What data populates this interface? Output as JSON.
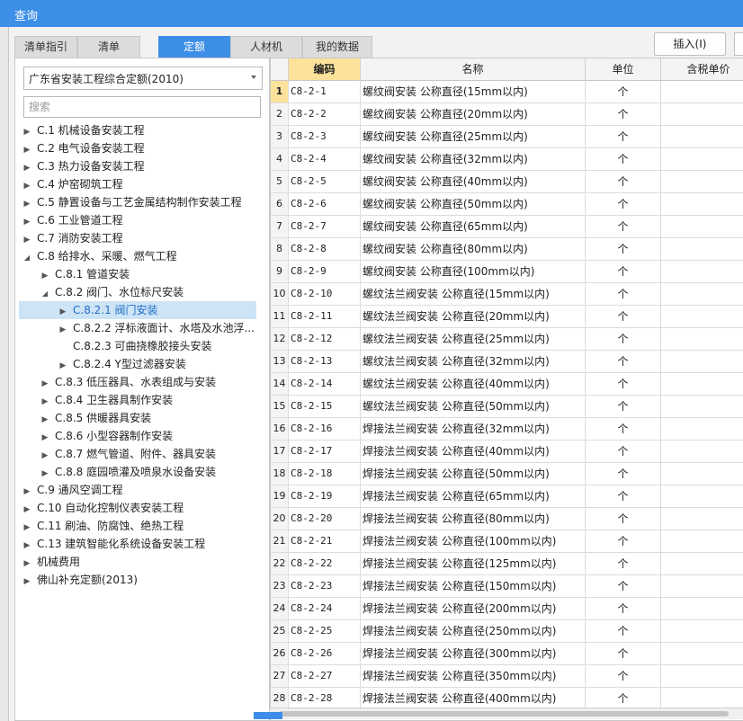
{
  "window": {
    "title": "查询"
  },
  "tabs": [
    {
      "label": "清单指引",
      "active": false
    },
    {
      "label": "清单",
      "active": false
    },
    {
      "label": "定额",
      "active": true
    },
    {
      "label": "人材机",
      "active": false
    },
    {
      "label": "我的数据",
      "active": false
    }
  ],
  "toolbar": {
    "insert_label": "插入(I)"
  },
  "left": {
    "library_select": "广东省安装工程综合定额(2010)",
    "search_placeholder": "搜索",
    "tree": [
      {
        "label": "C.1 机械设备安装工程",
        "level": 0,
        "caret": "right"
      },
      {
        "label": "C.2 电气设备安装工程",
        "level": 0,
        "caret": "right"
      },
      {
        "label": "C.3 热力设备安装工程",
        "level": 0,
        "caret": "right"
      },
      {
        "label": "C.4 炉窑砌筑工程",
        "level": 0,
        "caret": "right"
      },
      {
        "label": "C.5 静置设备与工艺金属结构制作安装工程",
        "level": 0,
        "caret": "right"
      },
      {
        "label": "C.6 工业管道工程",
        "level": 0,
        "caret": "right"
      },
      {
        "label": "C.7 消防安装工程",
        "level": 0,
        "caret": "right"
      },
      {
        "label": "C.8 给排水、采暖、燃气工程",
        "level": 0,
        "caret": "down"
      },
      {
        "label": "C.8.1 管道安装",
        "level": 1,
        "caret": "right"
      },
      {
        "label": "C.8.2 阀门、水位标尺安装",
        "level": 1,
        "caret": "down"
      },
      {
        "label": "C.8.2.1 阀门安装",
        "level": 2,
        "caret": "right",
        "selected": true
      },
      {
        "label": "C.8.2.2 浮标液面计、水塔及水池浮...",
        "level": 2,
        "caret": "right"
      },
      {
        "label": "C.8.2.3 可曲挠橡胶接头安装",
        "level": 2,
        "caret": "none"
      },
      {
        "label": "C.8.2.4 Y型过滤器安装",
        "level": 2,
        "caret": "right"
      },
      {
        "label": "C.8.3 低压器具、水表组成与安装",
        "level": 1,
        "caret": "right"
      },
      {
        "label": "C.8.4 卫生器具制作安装",
        "level": 1,
        "caret": "right"
      },
      {
        "label": "C.8.5 供暖器具安装",
        "level": 1,
        "caret": "right"
      },
      {
        "label": "C.8.6 小型容器制作安装",
        "level": 1,
        "caret": "right"
      },
      {
        "label": "C.8.7 燃气管道、附件、器具安装",
        "level": 1,
        "caret": "right"
      },
      {
        "label": "C.8.8 庭园喷灌及喷泉水设备安装",
        "level": 1,
        "caret": "right"
      },
      {
        "label": "C.9 通风空调工程",
        "level": 0,
        "caret": "right"
      },
      {
        "label": "C.10 自动化控制仪表安装工程",
        "level": 0,
        "caret": "right"
      },
      {
        "label": "C.11 刷油、防腐蚀、绝热工程",
        "level": 0,
        "caret": "right"
      },
      {
        "label": "C.13 建筑智能化系统设备安装工程",
        "level": 0,
        "caret": "right"
      },
      {
        "label": "机械费用",
        "level": 0,
        "caret": "right"
      },
      {
        "label": "佛山补充定额(2013)",
        "level": 0,
        "caret": "right"
      }
    ]
  },
  "grid": {
    "columns": [
      "编码",
      "名称",
      "单位",
      "含税单价"
    ],
    "rows": [
      {
        "no": "1",
        "code": "C8-2-1",
        "name": "螺纹阀安装 公称直径(15mm以内)",
        "unit": "个"
      },
      {
        "no": "2",
        "code": "C8-2-2",
        "name": "螺纹阀安装 公称直径(20mm以内)",
        "unit": "个"
      },
      {
        "no": "3",
        "code": "C8-2-3",
        "name": "螺纹阀安装 公称直径(25mm以内)",
        "unit": "个"
      },
      {
        "no": "4",
        "code": "C8-2-4",
        "name": "螺纹阀安装 公称直径(32mm以内)",
        "unit": "个"
      },
      {
        "no": "5",
        "code": "C8-2-5",
        "name": "螺纹阀安装 公称直径(40mm以内)",
        "unit": "个"
      },
      {
        "no": "6",
        "code": "C8-2-6",
        "name": "螺纹阀安装 公称直径(50mm以内)",
        "unit": "个"
      },
      {
        "no": "7",
        "code": "C8-2-7",
        "name": "螺纹阀安装 公称直径(65mm以内)",
        "unit": "个"
      },
      {
        "no": "8",
        "code": "C8-2-8",
        "name": "螺纹阀安装 公称直径(80mm以内)",
        "unit": "个"
      },
      {
        "no": "9",
        "code": "C8-2-9",
        "name": "螺纹阀安装 公称直径(100mm以内)",
        "unit": "个"
      },
      {
        "no": "10",
        "code": "C8-2-10",
        "name": "螺纹法兰阀安装 公称直径(15mm以内)",
        "unit": "个"
      },
      {
        "no": "11",
        "code": "C8-2-11",
        "name": "螺纹法兰阀安装 公称直径(20mm以内)",
        "unit": "个"
      },
      {
        "no": "12",
        "code": "C8-2-12",
        "name": "螺纹法兰阀安装 公称直径(25mm以内)",
        "unit": "个"
      },
      {
        "no": "13",
        "code": "C8-2-13",
        "name": "螺纹法兰阀安装 公称直径(32mm以内)",
        "unit": "个"
      },
      {
        "no": "14",
        "code": "C8-2-14",
        "name": "螺纹法兰阀安装 公称直径(40mm以内)",
        "unit": "个"
      },
      {
        "no": "15",
        "code": "C8-2-15",
        "name": "螺纹法兰阀安装 公称直径(50mm以内)",
        "unit": "个"
      },
      {
        "no": "16",
        "code": "C8-2-16",
        "name": "焊接法兰阀安装 公称直径(32mm以内)",
        "unit": "个"
      },
      {
        "no": "17",
        "code": "C8-2-17",
        "name": "焊接法兰阀安装 公称直径(40mm以内)",
        "unit": "个"
      },
      {
        "no": "18",
        "code": "C8-2-18",
        "name": "焊接法兰阀安装 公称直径(50mm以内)",
        "unit": "个"
      },
      {
        "no": "19",
        "code": "C8-2-19",
        "name": "焊接法兰阀安装 公称直径(65mm以内)",
        "unit": "个"
      },
      {
        "no": "20",
        "code": "C8-2-20",
        "name": "焊接法兰阀安装 公称直径(80mm以内)",
        "unit": "个"
      },
      {
        "no": "21",
        "code": "C8-2-21",
        "name": "焊接法兰阀安装 公称直径(100mm以内)",
        "unit": "个"
      },
      {
        "no": "22",
        "code": "C8-2-22",
        "name": "焊接法兰阀安装 公称直径(125mm以内)",
        "unit": "个"
      },
      {
        "no": "23",
        "code": "C8-2-23",
        "name": "焊接法兰阀安装 公称直径(150mm以内)",
        "unit": "个"
      },
      {
        "no": "24",
        "code": "C8-2-24",
        "name": "焊接法兰阀安装 公称直径(200mm以内)",
        "unit": "个"
      },
      {
        "no": "25",
        "code": "C8-2-25",
        "name": "焊接法兰阀安装 公称直径(250mm以内)",
        "unit": "个"
      },
      {
        "no": "26",
        "code": "C8-2-26",
        "name": "焊接法兰阀安装 公称直径(300mm以内)",
        "unit": "个"
      },
      {
        "no": "27",
        "code": "C8-2-27",
        "name": "焊接法兰阀安装 公称直径(350mm以内)",
        "unit": "个"
      },
      {
        "no": "28",
        "code": "C8-2-28",
        "name": "焊接法兰阀安装 公称直径(400mm以内)",
        "unit": "个"
      }
    ]
  }
}
